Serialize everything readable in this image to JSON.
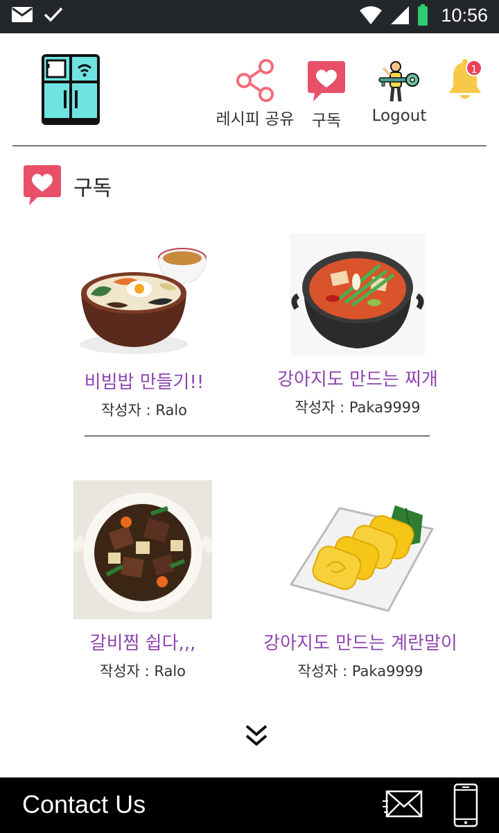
{
  "status_bar": {
    "time": "10:56"
  },
  "nav": {
    "share_label": "레시피 공유",
    "subscribe_label": "구독",
    "logout_label": "Logout",
    "notification_count": "1"
  },
  "section": {
    "title": "구독"
  },
  "recipes": [
    {
      "title": "비빔밥 만들기!!",
      "author": "작성자 : Ralo"
    },
    {
      "title": "강아지도 만드는 찌개",
      "author": "작성자 : Paka9999"
    },
    {
      "title": "갈비찜 쉽다,,,",
      "author": "작성자 : Ralo"
    },
    {
      "title": "강아지도 만드는 계란말이",
      "author": "작성자 : Paka9999"
    }
  ],
  "footer": {
    "title": "Contact Us"
  },
  "icons": {
    "share": "share-icon",
    "subscribe": "heart-chat-icon",
    "logout": "person-key-icon",
    "notifications": "bell-icon",
    "more": "double-chevron-down-icon",
    "mail": "envelope-icon",
    "phone": "phone-icon"
  },
  "colors": {
    "accent_purple": "#8e44ad",
    "heart_red": "#e8506a",
    "bell_yellow": "#f7c948",
    "status_bar": "#23272b",
    "footer": "#000000"
  }
}
